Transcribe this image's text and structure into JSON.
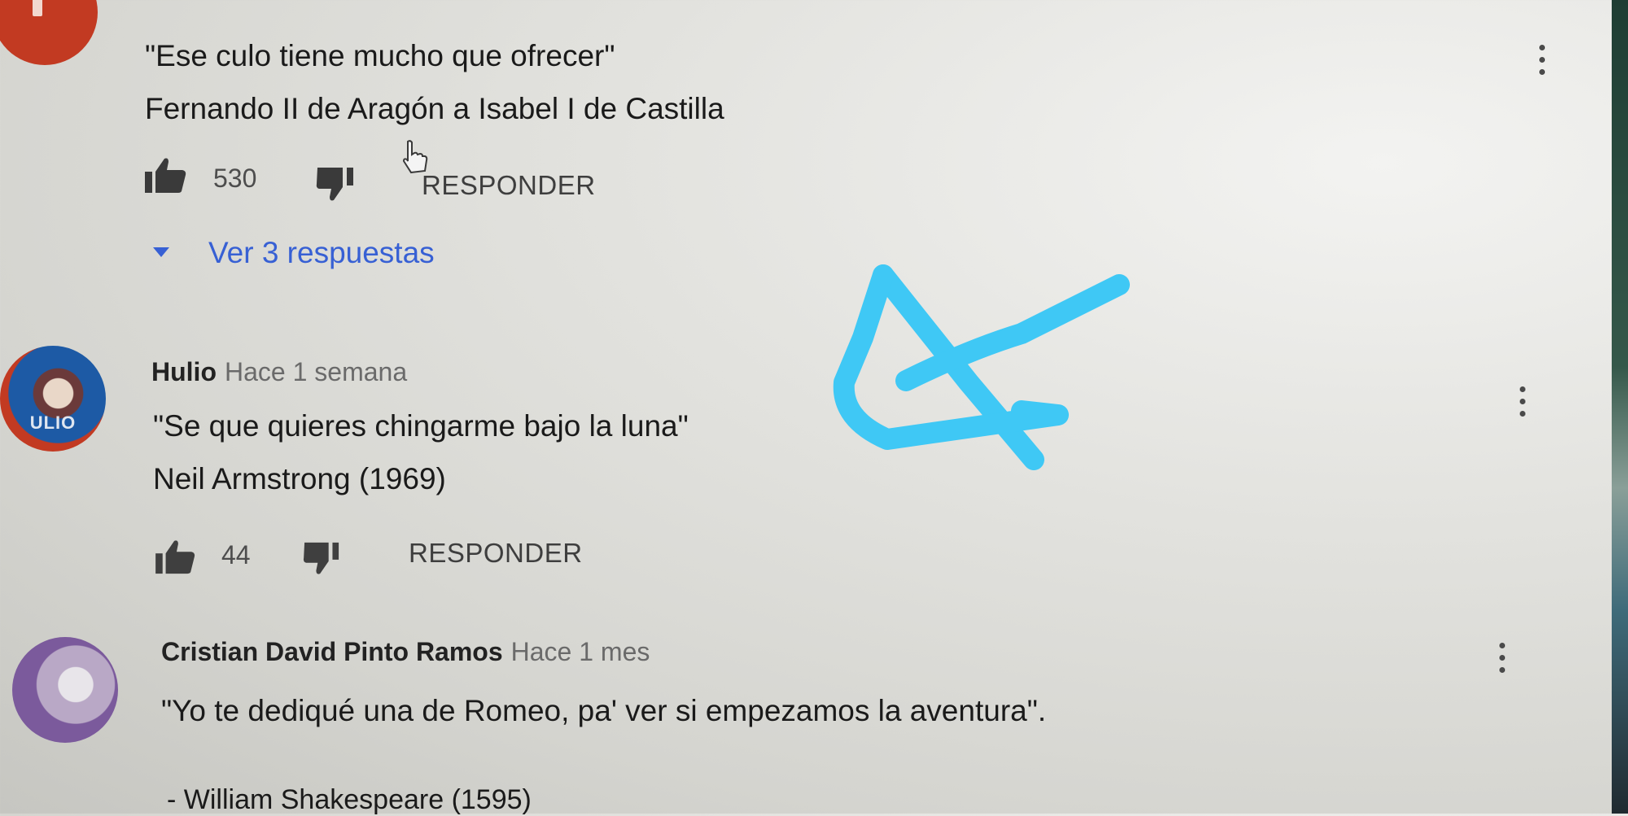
{
  "comments": [
    {
      "line1": "\"Ese culo tiene mucho que ofrecer\"",
      "line2": "Fernando II de Aragón a Isabel I de Castilla",
      "likes": "530",
      "reply_label": "RESPONDER",
      "replies_label": "Ver 3 respuestas"
    },
    {
      "author": "Hulio",
      "time": "Hace 1 semana",
      "avatar_label": "ULIO",
      "line1": "\"Se que quieres chingarme bajo la luna\"",
      "line2": "Neil Armstrong (1969)",
      "likes": "44",
      "reply_label": "RESPONDER"
    },
    {
      "author": "Cristian David Pinto Ramos",
      "time": "Hace 1 mes",
      "line1": "\"Yo te dediqué una de Romeo, pa' ver si empezamos la aventura\".",
      "line2": "- William Shakespeare (1595)"
    }
  ],
  "icons": {
    "like": "thumbs-up-icon",
    "dislike": "thumbs-down-icon",
    "expand": "caret-down-icon",
    "more": "more-vert-icon",
    "cursor": "hand-pointer-icon"
  },
  "colors": {
    "link_blue": "#3760d4",
    "annotation_cyan": "#3fc8f5",
    "avatar_red": "#c23a22"
  }
}
